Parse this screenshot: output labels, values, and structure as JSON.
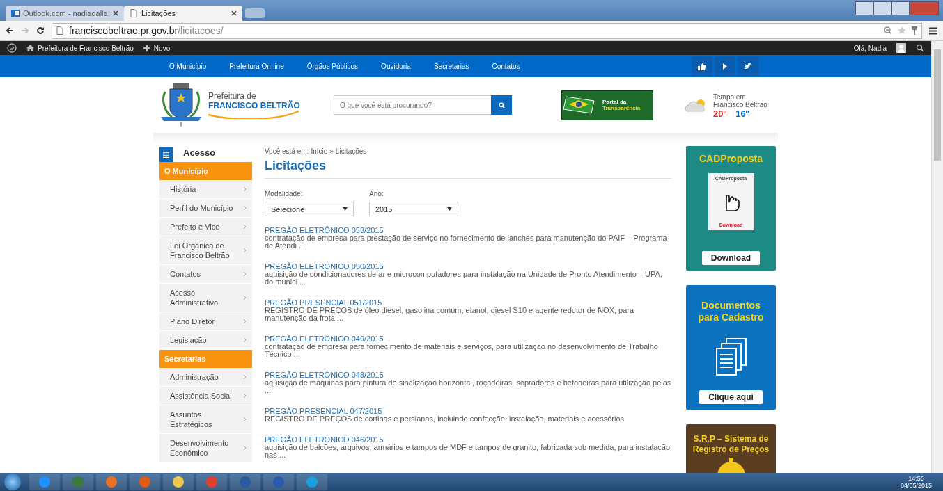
{
  "browser": {
    "tabs": [
      {
        "title": "Outlook.com - nadiadalla",
        "selected": false
      },
      {
        "title": "Licitações",
        "selected": true
      }
    ],
    "url": {
      "host": "franciscobeltrao.pr.gov.br",
      "path": "/licitacoes/"
    }
  },
  "admin_bar": {
    "site": "Prefeitura de Francisco Beltrão",
    "new": "Novo",
    "greeting": "Olá, Nadia"
  },
  "nav": {
    "items": [
      "O Município",
      "Prefeitura On-line",
      "Órgãos Públicos",
      "Ouvidoria",
      "Secretarias",
      "Contatos"
    ]
  },
  "header": {
    "logo_line1": "Prefeitura de",
    "logo_line2": "FRANCISCO BELTRÃO",
    "search_placeholder": "O que você está procurando?",
    "portal": {
      "line1": "Portal da",
      "line2": "Transparência"
    },
    "weather": {
      "line1": "Tempo em",
      "line2": "Francisco Beltrão",
      "max": "20º",
      "min": "16º"
    }
  },
  "sidebar": {
    "title": "Acesso",
    "groups": [
      {
        "title": "O Município",
        "items": [
          "História",
          "Perfil do Município",
          "Prefeito e Vice",
          "Lei Orgânica de Francisco Beltrão",
          "Contatos",
          "Acesso Administrativo",
          "Plano Diretor",
          "Legislação"
        ]
      },
      {
        "title": "Secretarias",
        "items": [
          "Administração",
          "Assistência Social",
          "Assuntos Estratégicos",
          "Desenvolvimento Econômico"
        ]
      }
    ]
  },
  "main": {
    "breadcrumb": {
      "prefix": "Você está em:",
      "home": "Início",
      "separator": "»",
      "current": "Licitações"
    },
    "title": "Licitações",
    "filters": [
      {
        "label": "Modalidade:",
        "value": "Selecione"
      },
      {
        "label": "Ano:",
        "value": "2015"
      }
    ],
    "results": [
      {
        "title": "PREGÃO ELETRÔNICO 053/2015",
        "description": "contratação de empresa para prestação de serviço no fornecimento de lanches para manutenção do PAIF – Programa de Atendi ..."
      },
      {
        "title": "PREGÃO ELETRONICO 050/2015",
        "description": "aquisição de condicionadores de ar e microcomputadores para instalação na Unidade de Pronto Atendimento – UPA, do munici ..."
      },
      {
        "title": "PREGÃO PRESENCIAL 051/2015",
        "description": "REGISTRO DE PREÇOS de óleo diesel, gasolina comum, etanol, diesel S10 e agente redutor de NOX, para manutenção da frota ..."
      },
      {
        "title": "PREGÃO ELETRÔNICO 049/2015",
        "description": "contratação de empresa para fornecimento de materiais e serviços, para utilização no desenvolvimento de Trabalho Técnico ..."
      },
      {
        "title": "PREGÃO ELETRÔNICO 048/2015",
        "description": "aquisição de máquinas para pintura de sinalização horizontal, roçadeiras,  sopradores e betoneiras para utilização pelas ..."
      },
      {
        "title": "PREGÃO PRESENCIAL 047/2015",
        "description": "REGISTRO DE PREÇOS de cortinas e persianas, incluindo confecção, instalação, materiais e acessórios"
      },
      {
        "title": "PREGÃO ELETRONICO 046/2015",
        "description": "aquisição de balcões, arquivos, armários e tampos de MDF e tampos de granito, fabricada sob medida, para instalação nas ..."
      }
    ]
  },
  "banners": [
    {
      "kind": "box",
      "title": "CADProposta",
      "box_title": "CADProposta",
      "box_caption": "Download",
      "button": "Download"
    },
    {
      "kind": "docs",
      "title": "Documentos para Cadastro",
      "button": "Clique aqui"
    },
    {
      "kind": "coin",
      "title": "S.R.P – Sistema de Registro de Preços"
    }
  ],
  "taskbar": {
    "time": "14:55",
    "date": "04/05/2015"
  }
}
